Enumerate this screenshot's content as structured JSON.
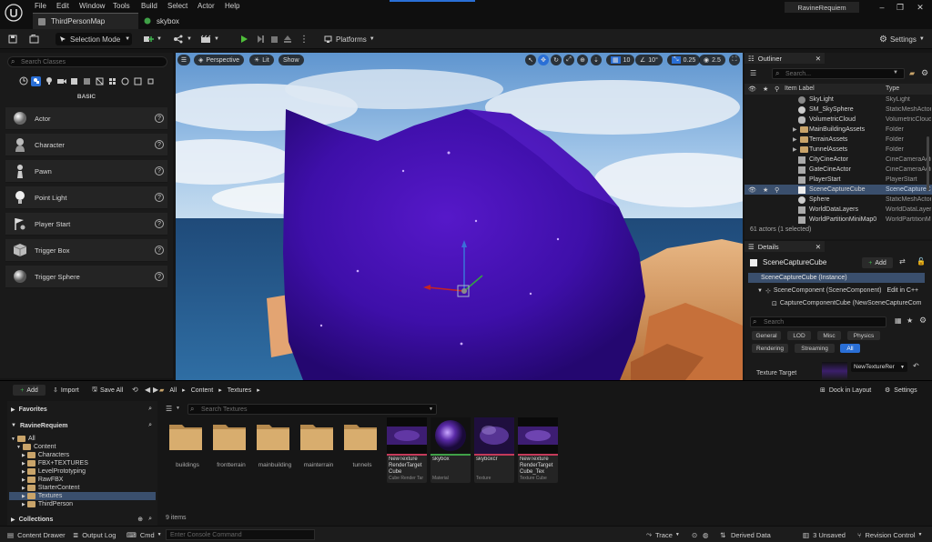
{
  "menu": [
    "File",
    "Edit",
    "Window",
    "Tools",
    "Build",
    "Select",
    "Actor",
    "Help"
  ],
  "tabs": [
    {
      "label": "ThirdPersonMap",
      "active": true
    },
    {
      "label": "skybox",
      "active": false
    }
  ],
  "project_name": "RavineRequiem",
  "toolbar": {
    "mode_label": "Selection Mode",
    "platforms_label": "Platforms",
    "settings_label": "Settings"
  },
  "place_actors": {
    "search_placeholder": "Search Classes",
    "category_label": "BASIC",
    "items": [
      {
        "label": "Actor",
        "icon": "sphere-icon"
      },
      {
        "label": "Character",
        "icon": "character-icon"
      },
      {
        "label": "Pawn",
        "icon": "pawn-icon"
      },
      {
        "label": "Point Light",
        "icon": "point-light-icon"
      },
      {
        "label": "Player Start",
        "icon": "player-start-icon"
      },
      {
        "label": "Trigger Box",
        "icon": "trigger-box-icon"
      },
      {
        "label": "Trigger Sphere",
        "icon": "trigger-sphere-icon"
      }
    ]
  },
  "viewport": {
    "perspective_label": "Perspective",
    "lit_label": "Lit",
    "show_label": "Show",
    "grid_snap": "10",
    "rotation_snap": "10°",
    "scale_snap": "0.25",
    "camera_speed": "2.5"
  },
  "outliner": {
    "title": "Outliner",
    "search_placeholder": "Search...",
    "col_label": "Item Label",
    "col_type": "Type",
    "rows": [
      {
        "name": "SkyLight",
        "type": "SkyLight",
        "indent": 2,
        "kind": "actor"
      },
      {
        "name": "SM_SkySphere",
        "type": "StaticMeshActor",
        "indent": 2,
        "kind": "actor"
      },
      {
        "name": "VolumetricCloud",
        "type": "VolumetricCloud",
        "indent": 2,
        "kind": "actor"
      },
      {
        "name": "MainBuildingAssets",
        "type": "Folder",
        "indent": 1,
        "kind": "folder"
      },
      {
        "name": "TerrainAssets",
        "type": "Folder",
        "indent": 1,
        "kind": "folder"
      },
      {
        "name": "TunnelAssets",
        "type": "Folder",
        "indent": 1,
        "kind": "folder"
      },
      {
        "name": "CityCineActor",
        "type": "CineCameraActor",
        "indent": 1,
        "kind": "actor"
      },
      {
        "name": "GateCineActor",
        "type": "CineCameraActor",
        "indent": 1,
        "kind": "actor"
      },
      {
        "name": "PlayerStart",
        "type": "PlayerStart",
        "indent": 1,
        "kind": "actor"
      },
      {
        "name": "SceneCaptureCube",
        "type": "SceneCaptureCube",
        "indent": 1,
        "kind": "actor",
        "selected": true
      },
      {
        "name": "Sphere",
        "type": "StaticMeshActor",
        "indent": 1,
        "kind": "actor"
      },
      {
        "name": "WorldDataLayers",
        "type": "WorldDataLayers",
        "indent": 1,
        "kind": "actor"
      },
      {
        "name": "WorldPartitionMiniMap0",
        "type": "WorldPartitionMiniMap",
        "indent": 1,
        "kind": "actor"
      }
    ],
    "footer": "61 actors (1 selected)"
  },
  "details": {
    "title": "Details",
    "actor_name": "SceneCaptureCube",
    "add_label": "Add",
    "components": [
      {
        "label": "SceneCaptureCube (Instance)",
        "selected": true
      },
      {
        "label": "SceneComponent (SceneComponent)",
        "link": "Edit in C++"
      },
      {
        "label": "CaptureComponentCube (NewSceneCaptureCom"
      }
    ],
    "search_placeholder": "Search",
    "categories": [
      "General",
      "LOD",
      "Misc",
      "Physics",
      "Rendering",
      "Streaming",
      "All"
    ],
    "active_category": "All",
    "property_label": "Texture Target",
    "property_value": "NewTextureRer"
  },
  "content_browser": {
    "add_label": "Add",
    "import_label": "Import",
    "save_all_label": "Save All",
    "breadcrumb": [
      "All",
      "Content",
      "Textures"
    ],
    "dock_label": "Dock in Layout",
    "settings_label": "Settings",
    "favorites_label": "Favorites",
    "project_label": "RavineRequiem",
    "collections_label": "Collections",
    "search_placeholder": "Search Textures",
    "tree": [
      {
        "label": "All",
        "indent": 0
      },
      {
        "label": "Content",
        "indent": 1
      },
      {
        "label": "Characters",
        "indent": 2
      },
      {
        "label": "FBX+TEXTURES",
        "indent": 2
      },
      {
        "label": "LevelPrototyping",
        "indent": 2
      },
      {
        "label": "RawFBX",
        "indent": 2
      },
      {
        "label": "StarterContent",
        "indent": 2
      },
      {
        "label": "Textures",
        "indent": 2,
        "selected": true
      },
      {
        "label": "ThirdPerson",
        "indent": 2
      }
    ],
    "folders": [
      "buildings",
      "frontterrain",
      "mainbuilding",
      "mainterrain",
      "tunnels"
    ],
    "assets": [
      {
        "name": "NewTexture RenderTarget Cube",
        "type": "Cube Render Tar",
        "color": "#c43a5a"
      },
      {
        "name": "skybox",
        "type": "Material",
        "color": "#3fa047"
      },
      {
        "name": "skyboxcr",
        "type": "Texture",
        "color": "#c43a5a"
      },
      {
        "name": "NewTexture RenderTarget Cube_Tex",
        "type": "Texture Cube",
        "color": "#c43a5a"
      }
    ],
    "item_count": "9 items"
  },
  "statusbar": {
    "content_drawer": "Content Drawer",
    "output_log": "Output Log",
    "cmd": "Cmd",
    "console_placeholder": "Enter Console Command",
    "trace": "Trace",
    "derived_data": "Derived Data",
    "unsaved": "3 Unsaved",
    "revision_control": "Revision Control"
  }
}
